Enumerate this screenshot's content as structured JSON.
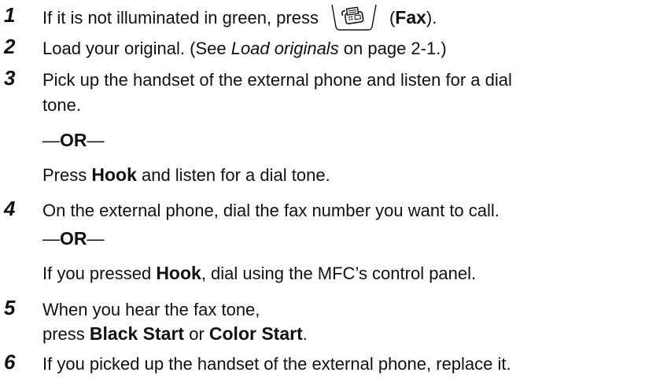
{
  "steps": [
    {
      "number": "1",
      "pre": "If it is not illuminated in green, press",
      "key_icon": "fax-icon",
      "post_open": "(",
      "post_bold": "Fax",
      "post_close": ")."
    },
    {
      "number": "2",
      "pre": "Load your original. (See ",
      "italic": "Load originals",
      "post": " on page 2-1.)"
    },
    {
      "number": "3",
      "line1": "Pick up the handset of the external phone and listen for a dial",
      "line2": "tone.",
      "or_dash": "—",
      "or_bold": "OR",
      "or_dash2": "—",
      "alt_pre": "Press ",
      "alt_bold": "Hook",
      "alt_post": " and listen for a dial tone."
    },
    {
      "number": "4",
      "line1": "On the external phone, dial the fax number you want to call.",
      "or_dash": "—",
      "or_bold": "OR",
      "or_dash2": "—",
      "alt_pre": "If you pressed ",
      "alt_bold": "Hook",
      "alt_post": ", dial using the MFC’s control panel."
    },
    {
      "number": "5",
      "line1": "When you hear the fax tone,",
      "line2_pre": "press ",
      "line2_bold1": "Black Start",
      "line2_mid": " or ",
      "line2_bold2": "Color Start",
      "line2_post": "."
    },
    {
      "number": "6",
      "line1": "If you picked up the handset of the external phone, replace it."
    }
  ]
}
